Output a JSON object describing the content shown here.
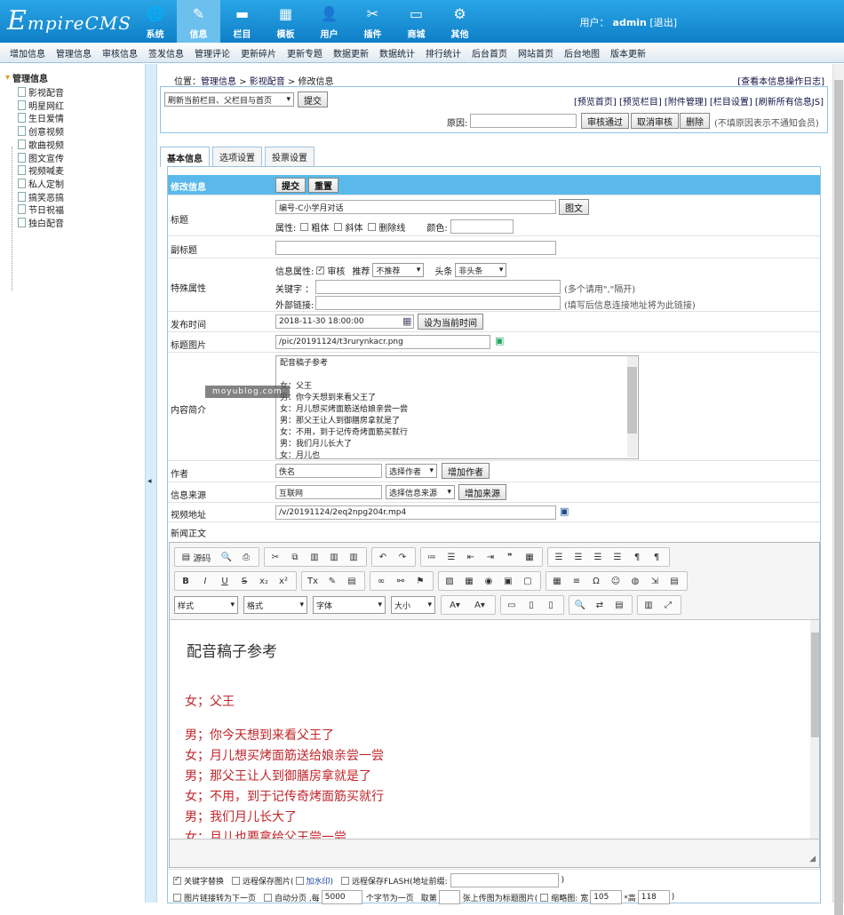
{
  "app": {
    "logo": "EmpireCMS",
    "logo_big": "E",
    "logo_rest": "mpireCMS"
  },
  "topnav": [
    {
      "label": "系统",
      "icon": "globe-icon",
      "glyph": "🌐"
    },
    {
      "label": "信息",
      "icon": "edit-icon",
      "glyph": "✎"
    },
    {
      "label": "栏目",
      "icon": "folder-icon",
      "glyph": "▬"
    },
    {
      "label": "模板",
      "icon": "template-icon",
      "glyph": "▦"
    },
    {
      "label": "用户",
      "icon": "user-icon",
      "glyph": "👤"
    },
    {
      "label": "插件",
      "icon": "tools-icon",
      "glyph": "✂"
    },
    {
      "label": "商城",
      "icon": "shop-icon",
      "glyph": "▭"
    },
    {
      "label": "其他",
      "icon": "gear-icon",
      "glyph": "⚙"
    }
  ],
  "user": {
    "prefix": "用户：",
    "name": "admin",
    "logout": "[退出]"
  },
  "subnav": [
    "增加信息",
    "管理信息",
    "审核信息",
    "签发信息",
    "管理评论",
    "更新碎片",
    "更新专题",
    "数据更新",
    "数据统计",
    "排行统计",
    "后台首页",
    "网站首页",
    "后台地图",
    "版本更新"
  ],
  "tree": {
    "root": "管理信息",
    "items": [
      "影视配音",
      "明星网红",
      "生日爱情",
      "创意视频",
      "歌曲视频",
      "图文宣传",
      "视频喊麦",
      "私人定制",
      "搞笑恶搞",
      "节日祝福",
      "独白配音"
    ]
  },
  "crumb": {
    "prefix": "位置：",
    "a": "管理信息",
    "sep": " > ",
    "b": "影视配音",
    "c": "修改信息"
  },
  "view_log": "[查看本信息操作日志]",
  "panel": {
    "refresh_select": "刷新当前栏目、父栏目与首页",
    "submit": "提交",
    "links": "[预览首页] [预览栏目] [附件管理] [栏目设置] [刷新所有信息JS]",
    "reason_label": "原因:",
    "approve": "审核通过",
    "cancel_approve": "取消审核",
    "delete": "删除",
    "hint": "(不填原因表示不通知会员)"
  },
  "tabs": [
    "基本信息",
    "选项设置",
    "投票设置"
  ],
  "form": {
    "header_label": "修改信息",
    "submit": "提交",
    "reset": "重置",
    "title_label": "标题",
    "title_value": "编号-C小学月对话",
    "tuwen": "图文",
    "attr_label": "属性:",
    "bold": "粗体",
    "italic": "斜体",
    "strike": "删除线",
    "color_label": "颜色:",
    "subtitle_label": "副标题",
    "special_label": "特殊属性",
    "info_attr": "信息属性:",
    "audit": "审核",
    "recommend": "推荐",
    "recommend_val": "不推荐",
    "headline": "头条",
    "headline_val": "非头条",
    "keyword_label": "关键字 ：",
    "keyword_hint": "(多个请用\",\"隔开)",
    "link_label": "外部链接:",
    "link_hint": "(填写后信息连接地址将为此链接)",
    "pubtime_label": "发布时间",
    "pubtime_value": "2018-11-30 18:00:00",
    "set_now": "设为当前时间",
    "titlepic_label": "标题图片",
    "titlepic_value": "/pic/20191124/t3rurynkacr.png",
    "summary_label": "内容简介",
    "summary_lines": [
      "配音稿子参考",
      "",
      "女：父王",
      "男：你今天想到来看父王了",
      "女：月儿想买烤面筋送给娘亲尝一尝",
      "男：那父王让人到御膳房拿就是了",
      "女：不用，到于记传奇烤面筋买就行",
      "男：我们月儿长大了",
      "女：月儿也"
    ],
    "watermark": "moyublog.com",
    "author_label": "作者",
    "author_value": "佚名",
    "author_select": "选择作者",
    "add_author": "增加作者",
    "source_label": "信息来源",
    "source_value": "互联网",
    "source_select": "选择信息来源",
    "add_source": "增加来源",
    "video_label": "视频地址",
    "video_value": "/v/20191124/2eq2npg204r.mp4",
    "body_label": "新闻正文"
  },
  "editor": {
    "source": "源码",
    "style": "样式",
    "format": "格式",
    "font": "字体",
    "size": "大小",
    "heading": "配音稿子参考",
    "lines": [
      "女；父王",
      "男；你今天想到来看父王了",
      "女；月儿想买烤面筋送给娘亲尝一尝",
      "男；那父王让人到御膳房拿就是了",
      "女；不用，到于记传奇烤面筋买就行",
      "男；我们月儿长大了",
      "女；月儿也要拿给父王尝一尝"
    ],
    "text_color": "#c0262b"
  },
  "footer": {
    "kw_replace": "关键字替换",
    "remote_img": "远程保存图片(",
    "watermark_link": "加水印)",
    "remote_flash": "远程保存FLASH(地址前缀:",
    "close": ")",
    "link_next": "图片链接转为下一页",
    "autopage": "自动分页 ,每",
    "autopage_num": "5000",
    "chars_per": "个字节为一页",
    "take": "取第",
    "set_titlepic": "张上传图为标题图片(",
    "thumb": "缩略图: 宽",
    "w": "105",
    "h_label": "*高",
    "h": "118",
    "end": ")"
  }
}
